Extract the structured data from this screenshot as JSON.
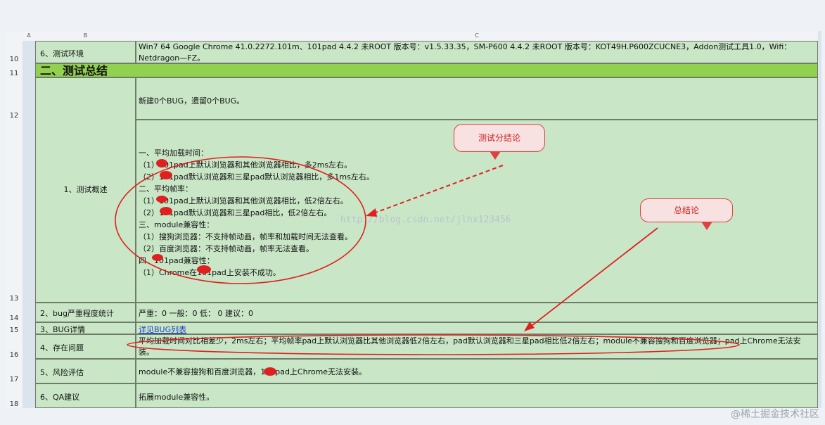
{
  "columns": {
    "a": "A",
    "b": "B",
    "c": "C"
  },
  "rows": [
    {
      "num": "10",
      "label": "6、测试环境",
      "content": "Win7 64 Google Chrome   41.0.2272.101m、101pad 4.4.2 未ROOT 版本号：v1.5.33.35，SM-P600 4.4.2 未ROOT 版本号：KOT49H.P600ZCUCNE3，Addon测试工具1.0，Wifi：Netdragon—FZ。"
    },
    {
      "num": "11",
      "section_title": "二、测试总结"
    },
    {
      "num": "12",
      "content": "新建0个BUG，遗留0个BUG。"
    },
    {
      "num": "13",
      "label": "1、测试概述",
      "lines": [
        "一、平均加载时间：",
        "（1）101pad上默认浏览器和其他浏览器相比，多2ms左右。",
        "（2）101pad默认浏览器和三星pad默认浏览器相比，多1ms左右。",
        "二、平均帧率：",
        "（1）101pad上默认浏览器和其他浏览器相比，低2倍左右。",
        "（2）101pad默认浏览器和三星pad相比，低2倍左右。",
        "三、module兼容性：",
        "（1）搜狗浏览器：不支持帧动画，帧率和加载时间无法查看。",
        "（2）百度浏览器：不支持帧动画，帧率无法查看。",
        "四、101pad兼容性：",
        "（1）Chrome在101pad上安装不成功。"
      ]
    },
    {
      "num": "14",
      "label": "2、bug严重程度统计",
      "content": "严重：0  一般：0  低：   0     建议：0"
    },
    {
      "num": "15",
      "label": "3、BUG详情",
      "content": "详见BUG列表"
    },
    {
      "num": "16",
      "label": "4、存在问题",
      "content": "平均加载时间对比相差少，2ms左右；平均帧率pad上默认浏览器比其他浏览器低2倍左右，pad默认浏览器和三星pad相比低2倍左右；module不兼容搜狗和百度浏览器；pad上Chrome无法安装。"
    },
    {
      "num": "17",
      "label": "5、风险评估",
      "content": "module不兼容搜狗和百度浏览器，101pad上Chrome无法安装。"
    },
    {
      "num": "18",
      "label": "6、QA建议",
      "content": "拓展module兼容性。"
    }
  ],
  "callouts": {
    "sub": "测试分结论",
    "total": "总结论"
  },
  "watermark": "http://blog.csdn.net/jlhx123456",
  "brand": "@稀土掘金技术社区",
  "colors": {
    "cell": "#c9e7c7",
    "section": "#92d050",
    "annotation": "#e02020"
  }
}
